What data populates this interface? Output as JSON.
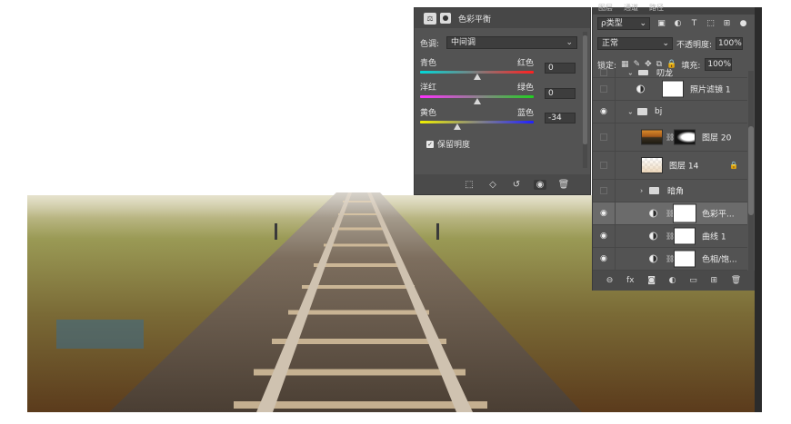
{
  "colors": {
    "panel_bg": "#535353",
    "panel_header": "#474747",
    "field_bg": "#3d3d3d",
    "selected_row": "#6b6b6b"
  },
  "color_balance": {
    "title": "色彩平衡",
    "tone_label": "色调:",
    "tone_value": "中间调",
    "sliders": [
      {
        "left": "青色",
        "right": "红色",
        "value": "0",
        "position": 0.5
      },
      {
        "left": "洋红",
        "right": "绿色",
        "value": "0",
        "position": 0.5
      },
      {
        "left": "黄色",
        "right": "蓝色",
        "value": "-34",
        "position": 0.33
      }
    ],
    "preserve_label": "保留明度",
    "preserve_checked": true,
    "footer_icons": [
      "clip-to-layer-icon",
      "view-previous-icon",
      "reset-icon",
      "visibility-icon",
      "trash-icon"
    ]
  },
  "layers": {
    "tabs": [
      "图层",
      "通道",
      "路径"
    ],
    "filter_label": "ρ类型",
    "blend_mode": "正常",
    "opacity_label": "不透明度:",
    "opacity_value": "100%",
    "lock_label": "锁定:",
    "fill_label": "填充:",
    "fill_value": "100%",
    "items": [
      {
        "name": "叨龙",
        "visible": false,
        "type": "partial"
      },
      {
        "name": "照片滤镜 1",
        "visible": false,
        "type": "adjustment"
      },
      {
        "name": "bj",
        "visible": true,
        "type": "group-open"
      },
      {
        "name": "图层 20",
        "visible": false,
        "type": "photo"
      },
      {
        "name": "图层 14",
        "visible": false,
        "type": "fade"
      },
      {
        "name": "暗角",
        "visible": false,
        "type": "group-closed"
      },
      {
        "name": "色彩平...",
        "visible": true,
        "type": "adjustment",
        "selected": true
      },
      {
        "name": "曲线 1",
        "visible": true,
        "type": "adjustment"
      },
      {
        "name": "色相/饱...",
        "visible": true,
        "type": "adjustment"
      }
    ]
  }
}
